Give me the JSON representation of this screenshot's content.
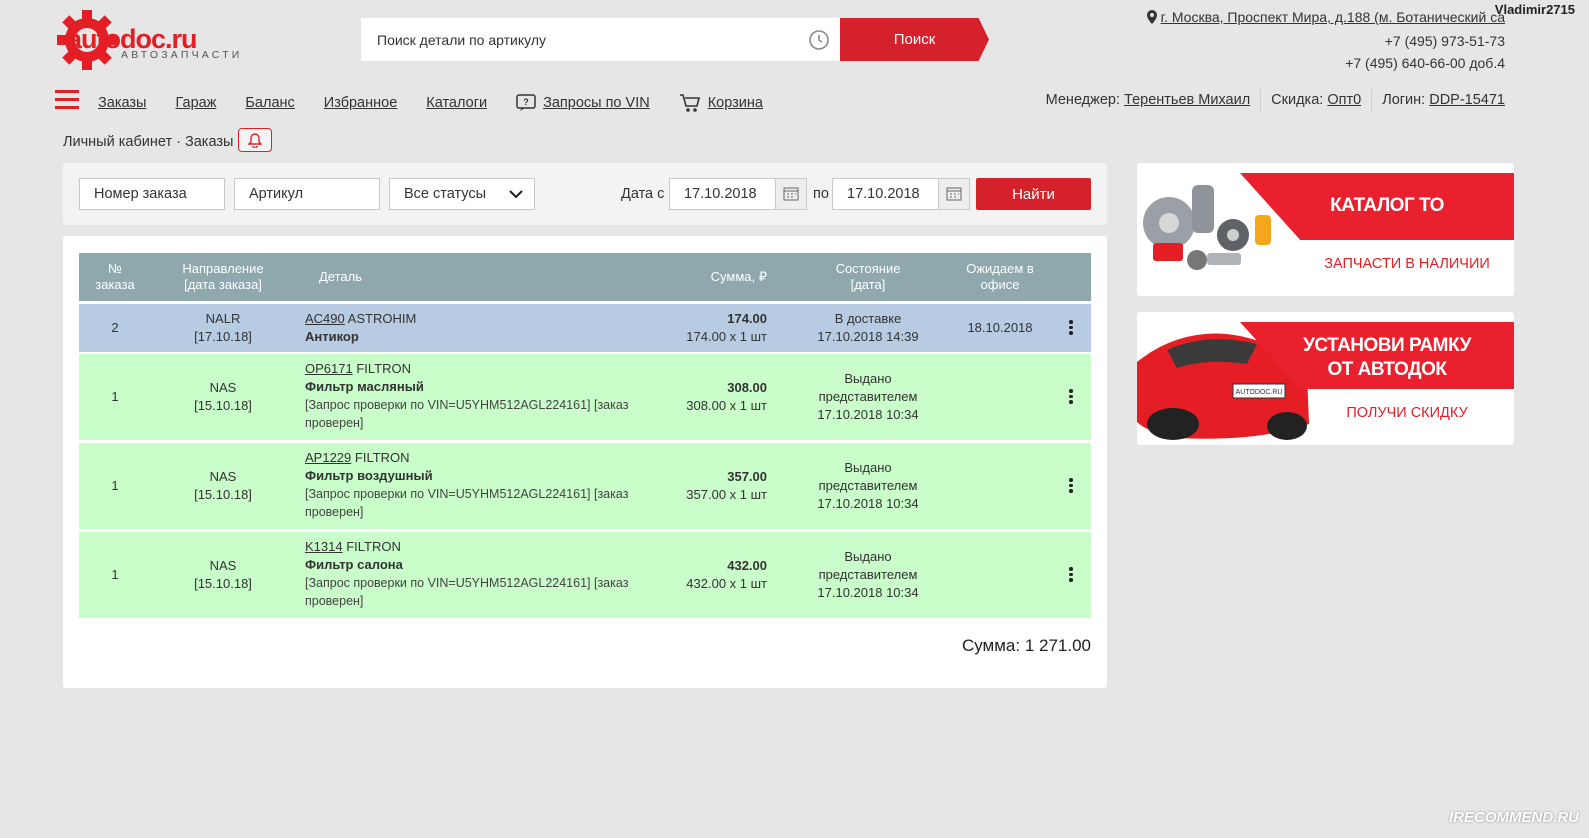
{
  "header": {
    "logo_text": "autodoc.ru",
    "logo_sub": "АВТОЗАПЧАСТИ",
    "search_placeholder": "Поиск детали по артикулу",
    "search_button": "Поиск",
    "address": "г. Москва, Проспект Мира, д.188 (м. Ботанический са",
    "phone1": "+7 (495) 973-51-73",
    "phone2": "+7 (495) 640-66-00 доб.4",
    "username": "Vladimir2715"
  },
  "nav": {
    "items": [
      "Заказы",
      "Гараж",
      "Баланс",
      "Избранное",
      "Каталоги",
      "Запросы по VIN",
      "Корзина"
    ],
    "manager_label": "Менеджер:",
    "manager_name": "Терентьев Михаил",
    "discount_label": "Скидка:",
    "discount_value": "Опт0",
    "login_label": "Логин:",
    "login_value": "DDP-15471"
  },
  "breadcrumb": "Личный кабинет · Заказы",
  "filter": {
    "order_placeholder": "Номер заказа",
    "article_placeholder": "Артикул",
    "status_selected": "Все статусы",
    "date_from_label": "Дата с",
    "date_from": "17.10.2018",
    "date_to_label": "по",
    "date_to": "17.10.2018",
    "find_button": "Найти"
  },
  "table": {
    "headers": {
      "num": "№\nзаказа",
      "direction": "Направление\n[дата заказа]",
      "detail": "Деталь",
      "sum": "Сумма, ₽",
      "status": "Состояние\n[дата]",
      "expected": "Ожидаем в\nофисе"
    },
    "rows": [
      {
        "num": "2",
        "dir": "NALR",
        "dir_date": "[17.10.18]",
        "article": "AC490",
        "brand": "ASTROHIM",
        "name": "Антикор",
        "note": "",
        "sum": "174.00",
        "sum_detail": "174.00 x 1 шт",
        "status": "В доставке\n17.10.2018 14:39",
        "expected": "18.10.2018"
      },
      {
        "num": "1",
        "dir": "NAS",
        "dir_date": "[15.10.18]",
        "article": "OP6171",
        "brand": "FILTRON",
        "name": "Фильтр масляный",
        "note": "[Запрос проверки по VIN=U5YHM512AGL224161] [заказ проверен]",
        "sum": "308.00",
        "sum_detail": "308.00 x 1 шт",
        "status": "Выдано\nпредставителем\n17.10.2018 10:34",
        "expected": ""
      },
      {
        "num": "1",
        "dir": "NAS",
        "dir_date": "[15.10.18]",
        "article": "AP1229",
        "brand": "FILTRON",
        "name": "Фильтр воздушный",
        "note": "[Запрос проверки по VIN=U5YHM512AGL224161] [заказ проверен]",
        "sum": "357.00",
        "sum_detail": "357.00 x 1 шт",
        "status": "Выдано\nпредставителем\n17.10.2018 10:34",
        "expected": ""
      },
      {
        "num": "1",
        "dir": "NAS",
        "dir_date": "[15.10.18]",
        "article": "K1314",
        "brand": "FILTRON",
        "name": "Фильтр салона",
        "note": "[Запрос проверки по VIN=U5YHM512AGL224161] [заказ проверен]",
        "sum": "432.00",
        "sum_detail": "432.00 x 1 шт",
        "status": "Выдано\nпредставителем\n17.10.2018 10:34",
        "expected": ""
      }
    ],
    "total": "Сумма: 1 271.00"
  },
  "banners": [
    {
      "title": "КАТАЛОГ ТО",
      "sub": "ЗАПЧАСТИ В НАЛИЧИИ"
    },
    {
      "title": "УСТАНОВИ РАМКУ\nОТ АВТОДОК",
      "sub": "ПОЛУЧИ СКИДКУ",
      "plate": "AUTODOC.RU"
    }
  ],
  "watermark": "IRECOMMEND.RU",
  "colors": {
    "accent": "#d4212b",
    "header_row": "#8ea8ad",
    "row_blue": "#b7cbe2",
    "row_green": "#c9fdc9"
  }
}
